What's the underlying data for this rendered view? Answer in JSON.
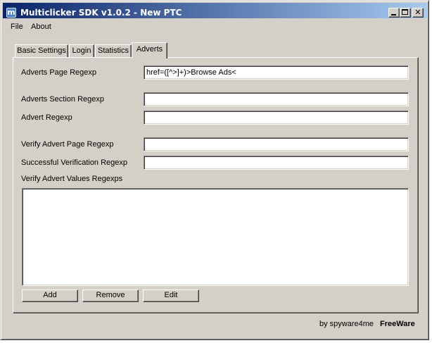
{
  "window": {
    "title": "Multiclicker SDK v1.0.2 - New PTC",
    "icon": "m-logo-icon",
    "controls": {
      "minimize_glyph": "",
      "maximize_glyph": "",
      "close_glyph": "✕"
    }
  },
  "menu": {
    "file": "File",
    "about": "About"
  },
  "tabs": [
    {
      "label": "Basic Settings",
      "active": false
    },
    {
      "label": "Login",
      "active": false
    },
    {
      "label": "Statistics",
      "active": false
    },
    {
      "label": "Adverts",
      "active": true
    }
  ],
  "form": {
    "adverts_page_regexp": {
      "label": "Adverts Page Regexp",
      "value": "href=([^>]+)>Browse Ads<"
    },
    "adverts_section_regexp": {
      "label": "Adverts Section Regexp",
      "value": ""
    },
    "advert_regexp": {
      "label": "Advert Regexp",
      "value": ""
    },
    "verify_advert_page_regexp": {
      "label": "Verify Advert Page Regexp",
      "value": ""
    },
    "successful_verification_regexp": {
      "label": "Successful Verification Regexp",
      "value": ""
    },
    "verify_advert_values_regexps": {
      "label": "Verify Advert Values Regexps",
      "items": []
    }
  },
  "buttons": {
    "add": "Add",
    "remove": "Remove",
    "edit": "Edit"
  },
  "footer": {
    "by": "by spyware4me",
    "license": "FreeWare"
  },
  "colors": {
    "titlebar_start": "#0a246a",
    "titlebar_end": "#a6caf0",
    "face": "#d4d0c8"
  }
}
